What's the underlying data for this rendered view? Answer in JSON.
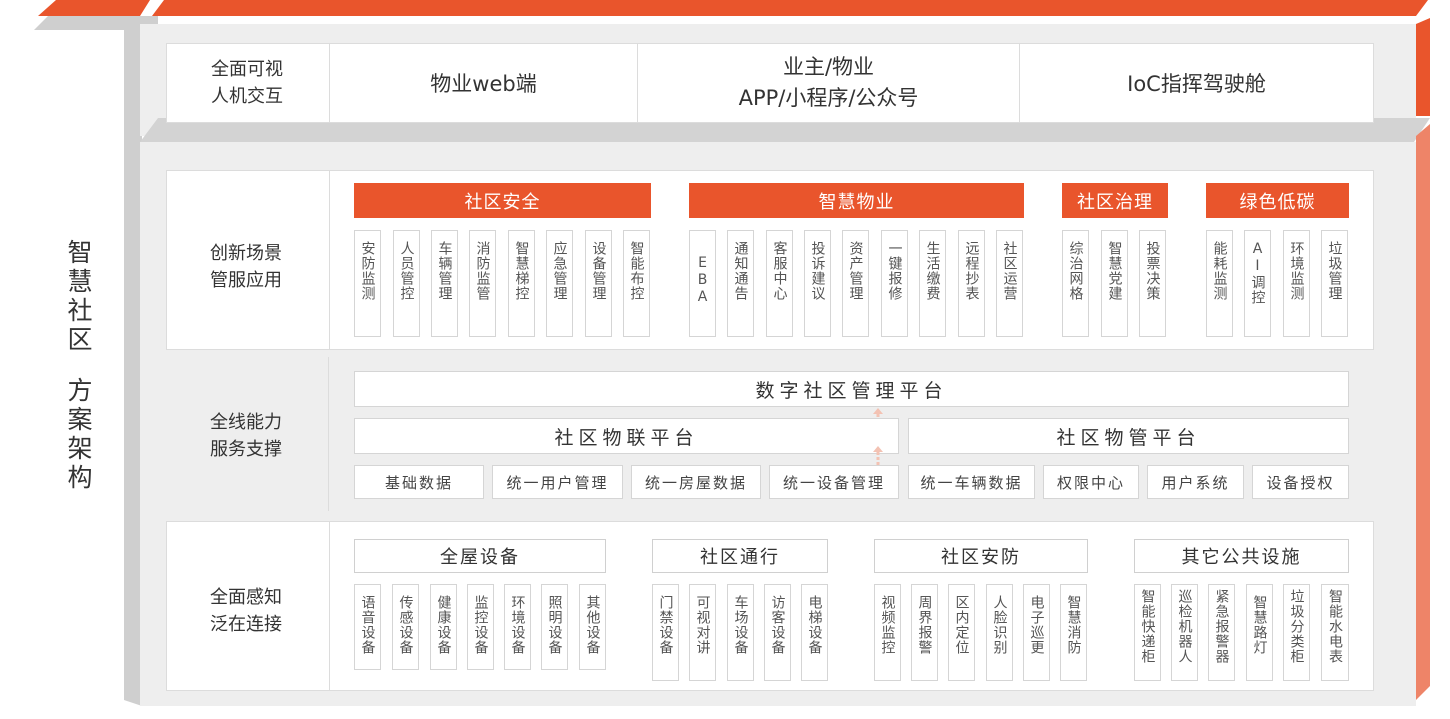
{
  "page": {
    "title_chars": [
      "智",
      "慧",
      "社",
      "区",
      "",
      "方",
      "案",
      "架",
      "构"
    ],
    "accent_color": "#e9552c"
  },
  "interaction": {
    "label_line1": "全面可视",
    "label_line2": "人机交互",
    "cells": [
      {
        "line1": "物业web端",
        "line2": ""
      },
      {
        "line1": "业主/物业",
        "line2": "APP/小程序/公众号"
      },
      {
        "line1": "IoC指挥驾驶舱",
        "line2": ""
      }
    ]
  },
  "applications": {
    "label_line1": "创新场景",
    "label_line2": "管服应用",
    "categories": [
      {
        "name": "社区安全",
        "items": [
          "安防监测",
          "人员管控",
          "车辆管理",
          "消防监管",
          "智慧梯控",
          "应急管理",
          "设备管理",
          "智能布控"
        ]
      },
      {
        "name": "智慧物业",
        "items": [
          "EBA",
          "通知通告",
          "客服中心",
          "投诉建议",
          "资产管理",
          "一键报修",
          "生活缴费",
          "远程抄表",
          "社区运营"
        ]
      },
      {
        "name": "社区治理",
        "items": [
          "综治网格",
          "智慧党建",
          "投票决策"
        ]
      },
      {
        "name": "绿色低碳",
        "items": [
          "能耗监测",
          "AI调控",
          "环境监测",
          "垃圾管理"
        ]
      }
    ]
  },
  "support": {
    "label_line1": "全线能力",
    "label_line2": "服务支撑",
    "top_platform": "数字社区管理平台",
    "platforms": [
      "社区物联平台",
      "社区物管平台"
    ],
    "services": [
      "基础数据",
      "统一用户管理",
      "统一房屋数据",
      "统一设备管理",
      "统一车辆数据",
      "权限中心",
      "用户系统",
      "设备授权"
    ]
  },
  "perception": {
    "label_line1": "全面感知",
    "label_line2": "泛在连接",
    "categories": [
      {
        "name": "全屋设备",
        "items": [
          "语音设备",
          "传感设备",
          "健康设备",
          "监控设备",
          "环境设备",
          "照明设备",
          "其他设备"
        ]
      },
      {
        "name": "社区通行",
        "items": [
          "门禁设备",
          "可视对讲",
          "车场设备",
          "访客设备",
          "电梯设备"
        ]
      },
      {
        "name": "社区安防",
        "items": [
          "视频监控",
          "周界报警",
          "区内定位",
          "人脸识别",
          "电子巡更",
          "智慧消防"
        ]
      },
      {
        "name": "其它公共设施",
        "items": [
          "智能快递柜",
          "巡检机器人",
          "紧急报警器",
          "智慧路灯",
          "垃圾分类柜",
          "智能水电表"
        ]
      }
    ]
  }
}
